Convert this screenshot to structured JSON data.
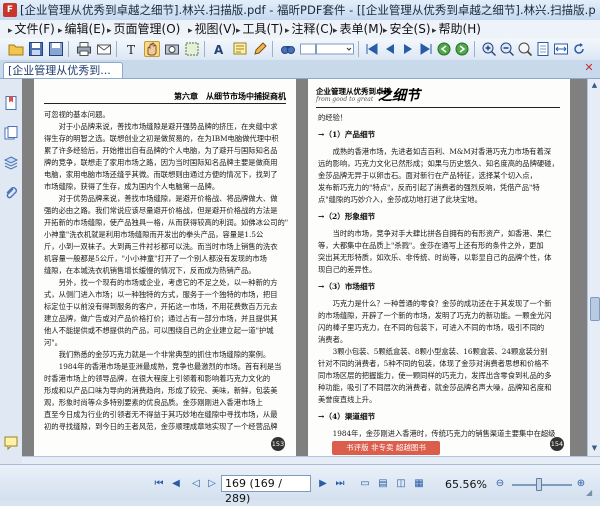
{
  "window": {
    "app_icon_label": "F",
    "title": "[企业管理从优秀到卓越之细节].林兴.扫描版.pdf - 福昕PDF套件 - [[企业管理从优秀到卓越之细节].林兴.扫描版.pdf]"
  },
  "menu": [
    "文件(F)",
    "编辑(E)",
    "页面管理(O)",
    "视图(V)",
    "工具(T)",
    "注释(C)",
    "表单(M)",
    "安全(S)",
    "帮助(H)"
  ],
  "tab": {
    "label": "[企业管理从优秀到..."
  },
  "left_page": {
    "running_head": "第六章　从细节市场中捕捉商机",
    "lines": [
      "可忽视的基本问题。",
      "　　对于小品牌来说，善找市场缝隙是避开强势品牌的挤压，在夹缝中求",
      "得生存的明智之选。联想创业之初是做贸易的，在为IBM电脑做代理中积",
      "累了许多经验后，开始推出自有品牌的个人电脑，为了避开与国际知名品",
      "牌的竞争，联想走了家用市场之路，因为当时国际知名品牌主要是做商用",
      "电脑，家用电脑市场还缝乎其微。而联想则由通过方便的情况下，找到了",
      "市场缝隙，获得了生存，成为国内个人电脑第一品牌。",
      "　　对于优势品牌来说，善找市场缝隙，是避开价格战、将品牌做大、做",
      "强的必由之路。我们常说应该尽量避开价格战，但是避开价格战的方法是",
      "开拓新的市场缝隙，使产品独具一格，从而获得较高的利润。如佛冰公司的\"小",
      "小神童\"洗衣机就是利用市场缝隙而开发出的拳头产品，容量是1.5公",
      "斤，小到一双袜子。大到两三件衬衫都可以洗。而当时市场上销售的洗衣",
      "机容量一般都是5公斤，\"小小神童\"打开了一个别人都没有发现的市场",
      "缝隙，在本城洗衣机销售增长缓慢的情况下，反而成为热销产品。",
      "　　另外，找一个现有的市场或企业，考虑它的不足之处，以一种新的方",
      "式，从侧门进入市场；以一种独特的方式，服务于一个独特的市场，把目",
      "标定位于以前没有得到服务的客户，开拓这一市场，不用花费数百万元去",
      "建立品牌，做广告或对产品价格打价；通过占有一部分市场，并且提供其",
      "他人不能提供或不想提供的产品，可以围绕自己的企业建立起一道\"护城",
      "河\"。",
      "　　我们熟悉的金莎巧克力就是一个非常典型的抓住市场缝隙的案例。",
      "　　1984年的香港市场是亚洲最成熟，竞争也最激烈的市场。首有利是当",
      "时香港市场上的领导品牌，在很大程度上引领着和影响着巧克力文化的",
      "形成和以产品口味为导向的消费趋向，形成了较完、美味，新鲜，包装美",
      "观，形象时尚等众多特别要素的优良品质。金莎刚刚进入香港市场上",
      "直至今日成为行业的引领者无不得益于其巧妙地在缝隙中寻找市场，从最",
      "初的寻找缝隙，到今日的王者风范，金莎顺理成章地实现了一个经营品牌"
    ],
    "page_number": "153"
  },
  "right_page": {
    "running_head_cn": "企业管理从优秀到卓越",
    "running_head_en": "from good to great",
    "running_head_big": "之细节",
    "blocks": [
      {
        "type": "line",
        "text": "的经验！"
      },
      {
        "type": "head",
        "text": "→（1）产品细节"
      },
      {
        "type": "line",
        "text": "　　成熟的香港市场，先进者如吉百利、M&M对香港巧克力市场有着深"
      },
      {
        "type": "line",
        "text": "远的影响，巧克力文化已然形成；如果与历史悠久、知名度高的品牌硬碰，"
      },
      {
        "type": "line",
        "text": "金莎品牌无异于以卵击石。面对新行在产品特征，选择某个切入点，"
      },
      {
        "type": "line",
        "text": "发布新巧克力的\"特点\"，反而引起了消费者的强烈反响，凭借产品\"特"
      },
      {
        "type": "line",
        "text": "点\"缝隙的巧妙介入，金莎成功地打进了此块宝地。"
      },
      {
        "type": "head",
        "text": "→（2）形象细节"
      },
      {
        "type": "line",
        "text": "　　当时的市场，竞争对手大肆比拼各自拥有的有形资产，如香港、果仁"
      },
      {
        "type": "line",
        "text": "等，大都集中在品质上\"杀戮\"。金莎在通写上还有形的条件之外，更加"
      },
      {
        "type": "line",
        "text": "突出其无形特质，如欢乐、非传统、时尚等，以彰显自己的品牌个性，体"
      },
      {
        "type": "line",
        "text": "现自己的差异性。"
      },
      {
        "type": "head",
        "text": "→（3）市场细节"
      },
      {
        "type": "line",
        "text": "　　巧克力是什么？一种普通的零食？金莎的成功还在于其发现了一个新"
      },
      {
        "type": "line",
        "text": "的市场缝隙，开辟了一个新的市场，发明了巧克力的新功能。一颗金光闪"
      },
      {
        "type": "line",
        "text": "闪的棒子里巧克力，在不同的包装下，可进入不同的市场，吸引不同的"
      },
      {
        "type": "line",
        "text": "消费者。"
      },
      {
        "type": "line",
        "text": "　　3颗小包装、5颗纸盒装、8颗小型盒装、16颗盒装、24颗盒装分别"
      },
      {
        "type": "line",
        "text": "针对不同的消费者，5种不同的包装，体现了金莎对消费者思想和价格不"
      },
      {
        "type": "line",
        "text": "同市场区层的把握能力，使一颗同样的巧克力，发挥出含零食到礼品的多"
      },
      {
        "type": "line",
        "text": "种功能，吸引了不同层次的消费者，就金莎品牌名声大噪，品牌知名度和"
      },
      {
        "type": "line",
        "text": "美誉度直线上升。"
      },
      {
        "type": "head",
        "text": "→（4）渠道细节"
      },
      {
        "type": "line",
        "text": "　　1984年，金莎刚进入香港时，传统巧克力的销售渠道主要集中在超级"
      }
    ],
    "page_number": "154"
  },
  "watermark_stamp": "书评版 非专卖 超越图书",
  "statusbar": {
    "page_input": "169 (169 / 289)",
    "zoom": "65.56%"
  },
  "colors": {
    "accent": "#2a5ba8",
    "viewer_bg": "#808080",
    "chrome": "#d9e4f1",
    "stamp": "#d84c3a"
  },
  "icons": {
    "toolbar": [
      "open-folder-icon",
      "save-icon",
      "print-icon",
      "select-text-icon",
      "hand-tool-icon",
      "snapshot-icon",
      "typewriter-icon",
      "find-icon",
      "first-page-icon",
      "prev-page-icon",
      "next-page-icon",
      "last-page-icon",
      "zoom-in-icon",
      "zoom-out-icon",
      "fit-page-icon",
      "fit-width-icon",
      "rotate-icon"
    ],
    "sidebar": [
      "bookmarks-icon",
      "pages-icon",
      "layers-icon",
      "attachments-icon",
      "comments-icon"
    ]
  }
}
